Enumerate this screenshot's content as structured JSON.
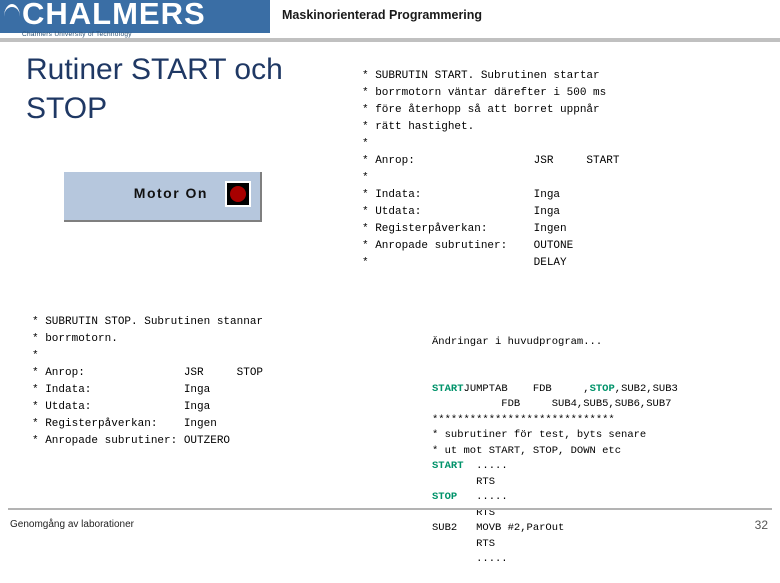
{
  "header": {
    "logo_wordmark": "CHALMERS",
    "logo_subtitle": "Chalmers University of Technology",
    "course_title": "Maskinorienterad Programmering"
  },
  "slide": {
    "title": "Rutiner START och STOP"
  },
  "motor_panel": {
    "label": "Motor On",
    "led_color": "#a80000",
    "panel_color": "#b6c7dd"
  },
  "code_blocks": {
    "start_routine": "* SUBRUTIN START. Subrutinen startar\n* borrmotorn väntar därefter i 500 ms\n* före återhopp så att borret uppnår\n* rätt hastighet.\n*\n* Anrop:                  JSR     START\n*\n* Indata:                 Inga\n* Utdata:                 Inga\n* Registerpåverkan:       Ingen\n* Anropade subrutiner:    OUTONE\n*                         DELAY",
    "stop_routine": "* SUBRUTIN STOP. Subrutinen stannar\n* borrmotorn.\n*\n* Anrop:               JSR     STOP\n* Indata:              Inga\n* Utdata:              Inga\n* Registerpåverkan:    Ingen\n* Anropade subrutiner: OUTZERO"
  },
  "main_program": {
    "heading": "Ändringar i huvudprogram...",
    "lines": [
      {
        "text": "JUMPTAB    FDB     ",
        "kw": "START",
        "text2": ",",
        "kw2": "STOP",
        "text3": ",SUB2,SUB3"
      },
      {
        "text": "           FDB     SUB4,SUB5,SUB6,SUB7"
      },
      {
        "text": "*****************************"
      },
      {
        "text": "* subrutiner för test, byts senare"
      },
      {
        "text": "* ut mot START, STOP, DOWN etc"
      },
      {
        "kw": "START",
        "text": "  ....."
      },
      {
        "text": "       RTS"
      },
      {
        "kw": "STOP",
        "text": "   ....."
      },
      {
        "text": "       RTS"
      },
      {
        "text": "SUB2   MOVB #2,ParOut"
      },
      {
        "text": "       RTS"
      },
      {
        "text": "       ....."
      }
    ],
    "keyword_color": "#00936a"
  },
  "footer": {
    "label": "Genomgång av laborationer",
    "page_number": "32"
  }
}
